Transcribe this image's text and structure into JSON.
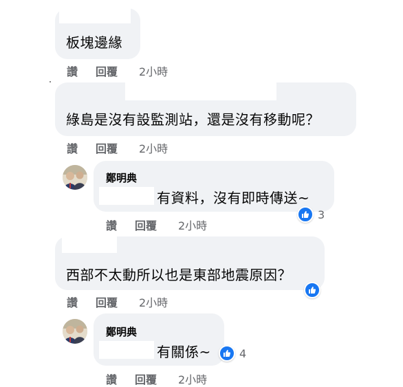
{
  "colors": {
    "bubble": "#f0f2f5",
    "text": "#050505",
    "meta": "#65676b",
    "like": "#1877f2"
  },
  "actions": {
    "like": "讚",
    "reply": "回覆"
  },
  "comments": [
    {
      "text": "板塊邊緣",
      "time": "2小時"
    },
    {
      "text": "綠島是沒有設監測站，還是沒有移動呢？",
      "time": "2小時"
    },
    {
      "author": "鄭明典",
      "text": "有資料，沒有即時傳送~",
      "time": "2小時",
      "reaction_icon": "like-icon",
      "reaction_count": "3"
    },
    {
      "text": "西部不太動所以也是東部地震原因？",
      "time": "2小時",
      "reaction_icon": "like-icon"
    },
    {
      "author": "鄭明典",
      "text": "有關係~",
      "time": "2小時",
      "reaction_icon": "like-icon",
      "reaction_count": "4"
    }
  ]
}
